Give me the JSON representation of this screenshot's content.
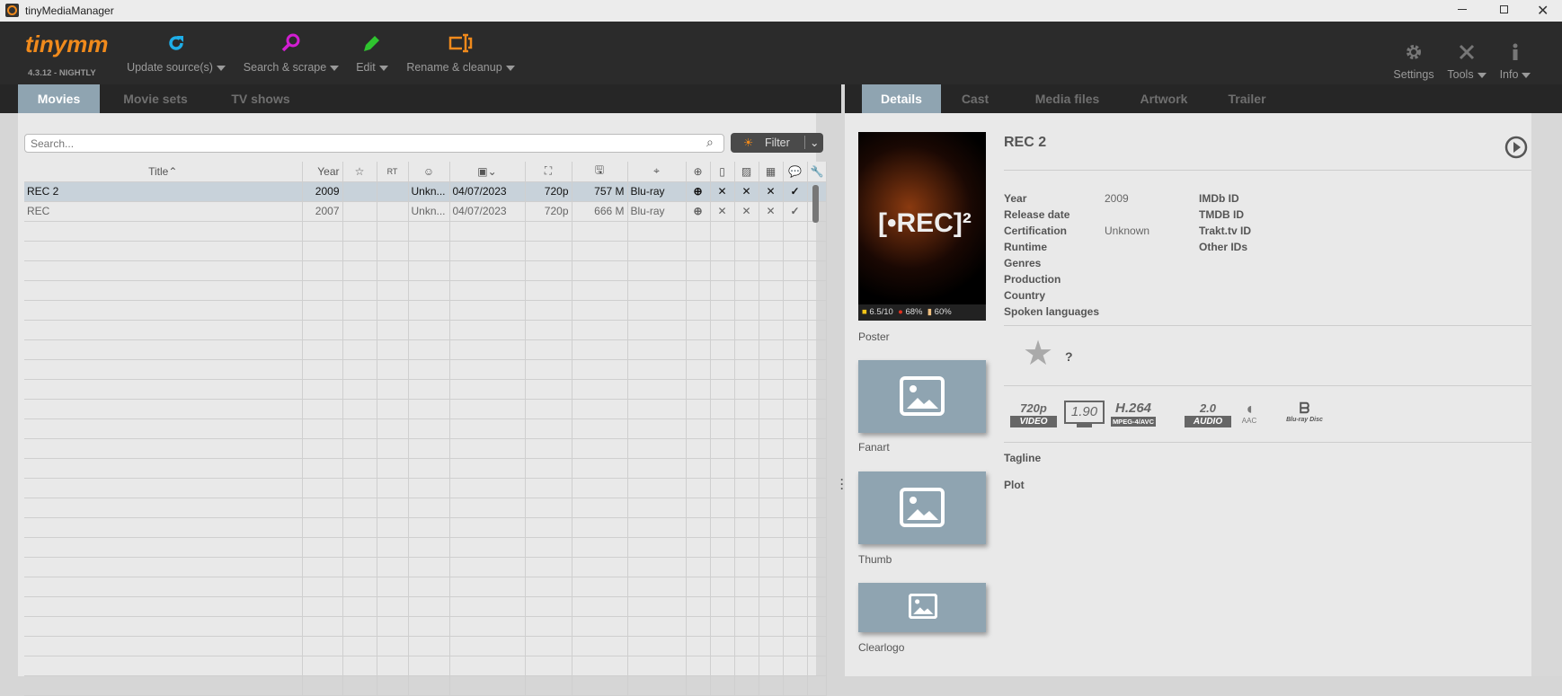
{
  "window": {
    "title": "tinyMediaManager"
  },
  "toolbar": {
    "logo": "tinymm",
    "version": "4.3.12 - NIGHTLY",
    "update": "Update source(s)",
    "search": "Search & scrape",
    "edit": "Edit",
    "rename": "Rename & cleanup",
    "settings": "Settings",
    "tools": "Tools",
    "info": "Info"
  },
  "left_tabs": [
    "Movies",
    "Movie sets",
    "TV shows"
  ],
  "search": {
    "placeholder": "Search..."
  },
  "filter": {
    "label": "Filter"
  },
  "table": {
    "headers": {
      "title": "Title",
      "year": "Year",
      "rt": "RT"
    },
    "rows": [
      {
        "title": "REC 2",
        "year": "2009",
        "cert": "Unkn...",
        "date": "04/07/2023",
        "res": "720p",
        "size": "757 M",
        "source": "Blu-ray",
        "nfo": "✕",
        "art": "✕",
        "trailer": "✕",
        "subs": "✓"
      },
      {
        "title": "REC",
        "year": "2007",
        "cert": "Unkn...",
        "date": "04/07/2023",
        "res": "720p",
        "size": "666 M",
        "source": "Blu-ray",
        "nfo": "✕",
        "art": "✕",
        "trailer": "✕",
        "subs": "✓"
      }
    ]
  },
  "right_tabs": [
    "Details",
    "Cast",
    "Media files",
    "Artwork",
    "Trailer"
  ],
  "details": {
    "title": "REC 2",
    "poster_text": "[•REC]²",
    "ratings": {
      "imdb": "6.5/10",
      "rt": "68%",
      "popcorn": "60%"
    },
    "labels": {
      "year": "Year",
      "release": "Release date",
      "cert": "Certification",
      "runtime": "Runtime",
      "genres": "Genres",
      "production": "Production",
      "country": "Country",
      "languages": "Spoken languages",
      "imdb": "IMDb ID",
      "tmdb": "TMDB ID",
      "trakt": "Trakt.tv ID",
      "other": "Other IDs",
      "tagline": "Tagline",
      "plot": "Plot"
    },
    "values": {
      "year": "2009",
      "cert": "Unknown"
    },
    "user_rating": "?",
    "media": {
      "res": "720p",
      "video": "VIDEO",
      "aspect": "1.90",
      "codec": "H.264",
      "codec_sub": "MPEG-4/AVC",
      "channels": "2.0",
      "audio": "AUDIO",
      "aac": "AAC",
      "disc": "Blu-ray Disc"
    },
    "artwork": [
      "Poster",
      "Fanart",
      "Thumb",
      "Clearlogo"
    ]
  }
}
